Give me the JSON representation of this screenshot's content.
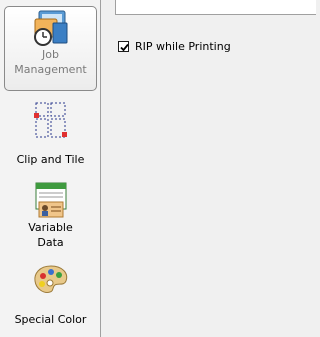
{
  "sidebar": {
    "items": [
      {
        "label_line1": "Job",
        "label_line2": "Management",
        "icon": "job-management-icon",
        "selected": true
      },
      {
        "label": "Clip and Tile",
        "icon": "clip-and-tile-icon"
      },
      {
        "label_line1": "Variable",
        "label_line2": "Data",
        "icon": "variable-data-icon"
      },
      {
        "label": "Special Color",
        "icon": "palette-icon"
      }
    ]
  },
  "main": {
    "rip_while_printing": {
      "label": "RIP while Printing",
      "checked": true
    }
  }
}
